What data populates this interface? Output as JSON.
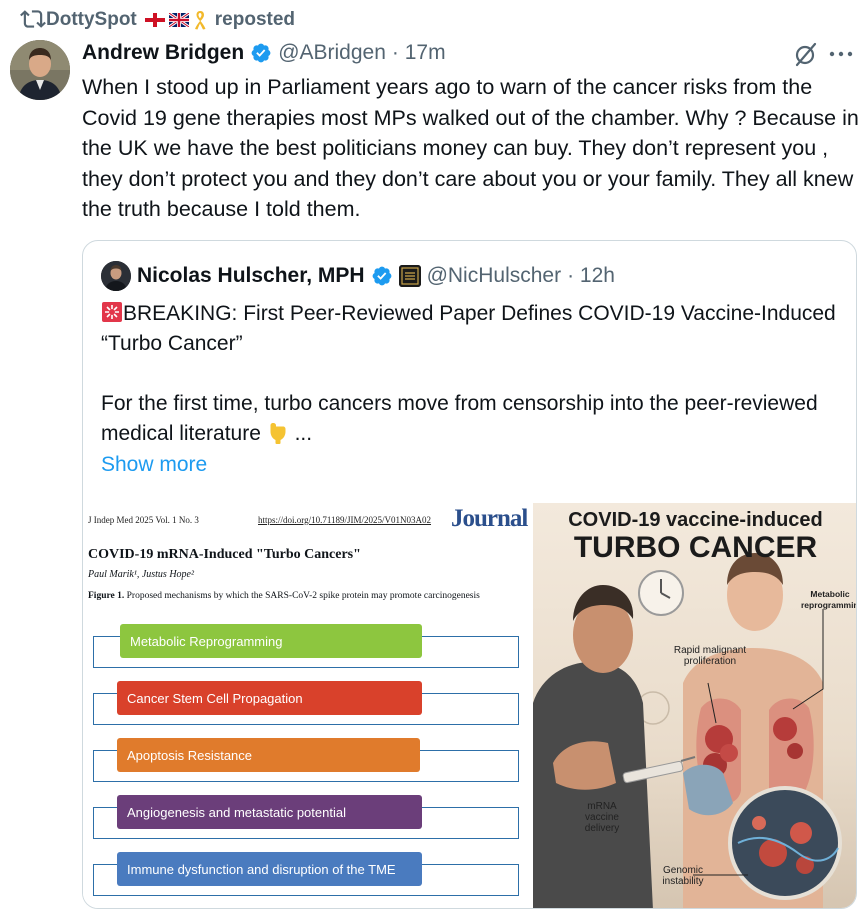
{
  "repost": {
    "user": "DottySpot",
    "suffix": "reposted"
  },
  "tweet": {
    "author_name": "Andrew Bridgen",
    "handle": "@ABridgen",
    "time": "· 17m",
    "text": "When I stood up in Parliament years ago to warn of the cancer risks from the Covid 19 gene therapies most MPs walked out of the chamber. Why ? Because in the UK we have the best politicians money can buy. They don’t represent you , they don’t protect you and they don’t care about you or your family.  They all  knew the truth because I told them."
  },
  "quote": {
    "author_name": "Nicolas Hulscher, MPH",
    "handle": "@NicHulscher",
    "time": "· 12h",
    "line1": "BREAKING: First Peer-Reviewed Paper Defines COVID-19 Vaccine-Induced “Turbo Cancer”",
    "line2": "For the first time, turbo cancers move from censorship into the peer-reviewed medical literature",
    "ellipsis": "...",
    "show_more": "Show more"
  },
  "paper": {
    "meta": "J Indep Med 2025 Vol. 1 No. 3",
    "doi": "https://doi.org/10.71189/JIM/2025/V01N03A02",
    "journal": "Journal",
    "title": "COVID-19 mRNA-Induced \"Turbo Cancers\"",
    "authors": "Paul Marik¹, Justus Hope²",
    "figure_label": "Figure 1.",
    "figure_caption": "Proposed mechanisms by which the SARS-CoV-2 spike protein may promote carcinogenesis",
    "mechanisms": [
      {
        "label": "Metabolic Reprogramming",
        "color": "#8dc63f"
      },
      {
        "label": "Cancer Stem Cell Propagation",
        "color": "#d9412b"
      },
      {
        "label": "Apoptosis Resistance",
        "color": "#e07b2c"
      },
      {
        "label": "Angiogenesis and metastatic potential",
        "color": "#6b3e7a"
      },
      {
        "label": "Immune dysfunction and disruption of the TME",
        "color": "#4a7bbf"
      }
    ]
  },
  "art": {
    "title1": "COVID-19 vaccine-induced",
    "title2": "TURBO CANCER",
    "label_metabolic": "Metabolic reprogramming",
    "label_rapid": "Rapid malignant proliferation",
    "label_mrna": "mRNA vaccine delivery",
    "label_genomic": "Genomic instability"
  }
}
